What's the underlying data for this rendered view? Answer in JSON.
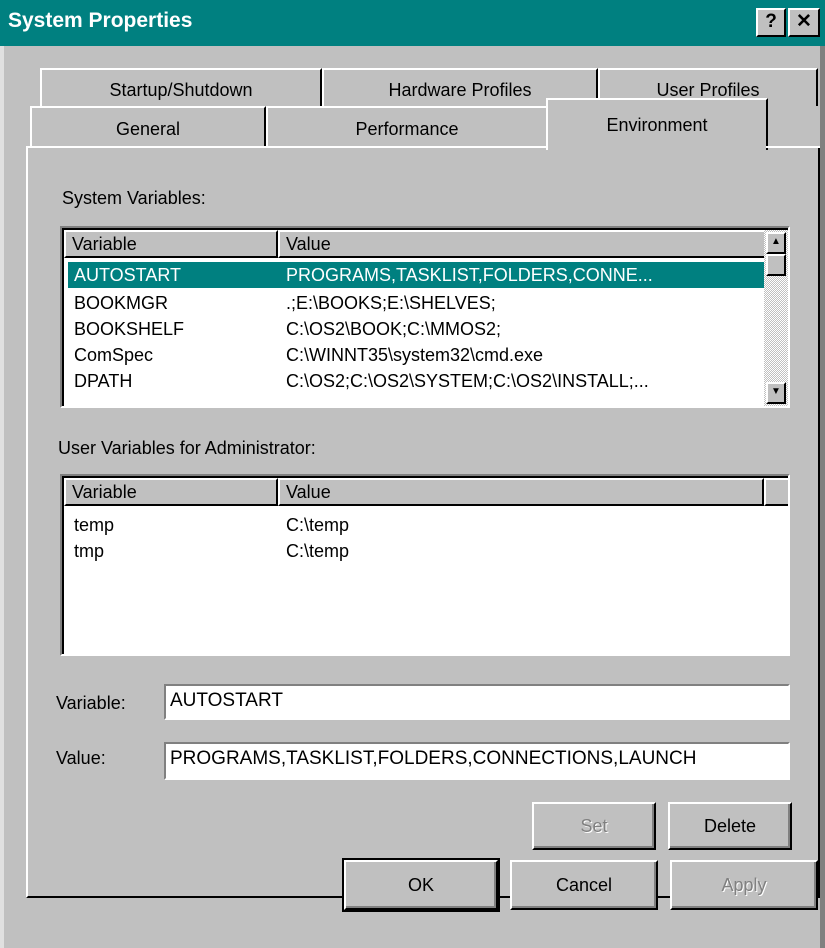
{
  "window": {
    "title": "System Properties",
    "help_glyph": "?",
    "close_glyph": "✕"
  },
  "tabs_back": [
    {
      "label": "Startup/Shutdown"
    },
    {
      "label": "Hardware Profiles"
    },
    {
      "label": "User Profiles"
    }
  ],
  "tabs_front": [
    {
      "label": "General"
    },
    {
      "label": "Performance"
    },
    {
      "label": "Environment"
    }
  ],
  "active_tab": "Environment",
  "system_vars": {
    "label": "System Variables:",
    "columns": [
      "Variable",
      "Value"
    ],
    "rows": [
      {
        "name": "AUTOSTART",
        "value": "PROGRAMS,TASKLIST,FOLDERS,CONNE..."
      },
      {
        "name": "BOOKMGR",
        "value": ".;E:\\BOOKS;E:\\SHELVES;"
      },
      {
        "name": "BOOKSHELF",
        "value": "C:\\OS2\\BOOK;C:\\MMOS2;"
      },
      {
        "name": "ComSpec",
        "value": "C:\\WINNT35\\system32\\cmd.exe"
      },
      {
        "name": "DPATH",
        "value": "C:\\OS2;C:\\OS2\\SYSTEM;C:\\OS2\\INSTALL;..."
      }
    ],
    "selected_row": "AUTOSTART"
  },
  "user_vars": {
    "label": "User Variables for Administrator:",
    "columns": [
      "Variable",
      "Value"
    ],
    "rows": [
      {
        "name": "temp",
        "value": "C:\\temp"
      },
      {
        "name": "tmp",
        "value": "C:\\temp"
      }
    ]
  },
  "fields": {
    "variable_label": "Variable:",
    "variable_value": "AUTOSTART",
    "value_label": "Value:",
    "value_value": "PROGRAMS,TASKLIST,FOLDERS,CONNECTIONS,LAUNCH"
  },
  "buttons": {
    "set": "Set",
    "delete": "Delete",
    "ok": "OK",
    "cancel": "Cancel",
    "apply": "Apply"
  },
  "colors": {
    "titlebar": "#008080",
    "selection": "#008080",
    "face": "#c0c0c0"
  }
}
